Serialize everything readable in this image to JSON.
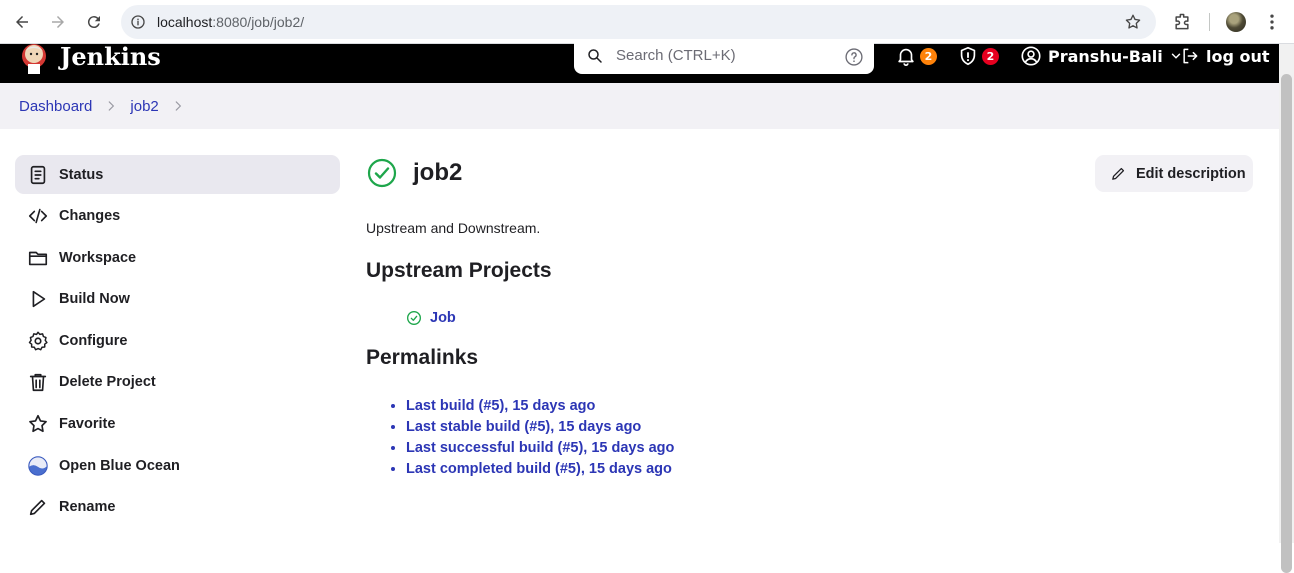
{
  "browser": {
    "url_host": "localhost",
    "url_rest": ":8080/job/job2/"
  },
  "header": {
    "brand": "Jenkins",
    "search_placeholder": "Search (CTRL+K)",
    "notifications_count": "2",
    "security_count": "2",
    "username": "Pranshu-Bali",
    "logout_label": "log out"
  },
  "breadcrumb": {
    "items": [
      "Dashboard",
      "job2"
    ]
  },
  "sidebar": {
    "items": [
      {
        "label": "Status",
        "icon": "document-icon"
      },
      {
        "label": "Changes",
        "icon": "code-icon"
      },
      {
        "label": "Workspace",
        "icon": "folder-icon"
      },
      {
        "label": "Build Now",
        "icon": "play-icon"
      },
      {
        "label": "Configure",
        "icon": "gear-icon"
      },
      {
        "label": "Delete Project",
        "icon": "trash-icon"
      },
      {
        "label": "Favorite",
        "icon": "star-icon"
      },
      {
        "label": "Open Blue Ocean",
        "icon": "blue-ocean-icon"
      },
      {
        "label": "Rename",
        "icon": "pencil-icon"
      }
    ]
  },
  "main": {
    "job_name": "job2",
    "edit_description_label": "Edit description",
    "description": "Upstream and Downstream.",
    "upstream_heading": "Upstream Projects",
    "upstream_projects": [
      "Job"
    ],
    "permalinks_heading": "Permalinks",
    "permalinks": [
      "Last build (#5), 15 days ago",
      "Last stable build (#5), 15 days ago",
      "Last successful build (#5), 15 days ago",
      "Last completed build (#5), 15 days ago"
    ]
  },
  "colors": {
    "link": "#2c36b5",
    "success": "#1ea64b",
    "header_bg": "#000000",
    "badge_orange": "#fe820a",
    "badge_red": "#e6001f"
  }
}
